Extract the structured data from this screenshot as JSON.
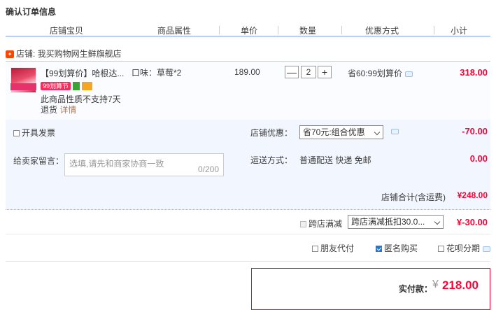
{
  "title": "确认订单信息",
  "columns": {
    "shop_item": "店铺宝贝",
    "attributes": "商品属性",
    "unit_price": "单价",
    "quantity": "数量",
    "discount_method": "优惠方式",
    "subtotal": "小计"
  },
  "shop": {
    "label": "店铺: 我买购物网生鲜旗舰店"
  },
  "item": {
    "name": "【99划算价】哈根达...",
    "tag": "99划算节",
    "attribute": "口味：草莓*2",
    "price": "189.00",
    "qty_minus": "—",
    "qty": "2",
    "qty_plus": "+",
    "promo": "省60:99划算价",
    "subtotal": "318.00",
    "note_line1": "此商品性质不支持7天",
    "note_line2": "退货",
    "note_link": "详情"
  },
  "invoice": {
    "label": "开具发票"
  },
  "shop_discount": {
    "label": "店铺优惠：",
    "selected": "省70元:组合优惠",
    "amount": "-70.00"
  },
  "message": {
    "label": "给卖家留言：",
    "placeholder": "选填,请先和商家协商一致",
    "count": "0/200"
  },
  "shipping": {
    "label": "运送方式：",
    "value": "普通配送 快递 免邮",
    "amount": "0.00"
  },
  "shop_total": {
    "label": "店铺合计(含运费)",
    "amount": "¥248.00"
  },
  "cross_store": {
    "label": "跨店满减",
    "selected": "跨店满减抵扣30.0...",
    "amount": "¥-30.00"
  },
  "options": {
    "friend_pay": "朋友代付",
    "anonymous": "匿名购买",
    "huabei": "花呗分期"
  },
  "payment": {
    "label": "实付款：",
    "currency": "¥",
    "amount": "218.00"
  }
}
